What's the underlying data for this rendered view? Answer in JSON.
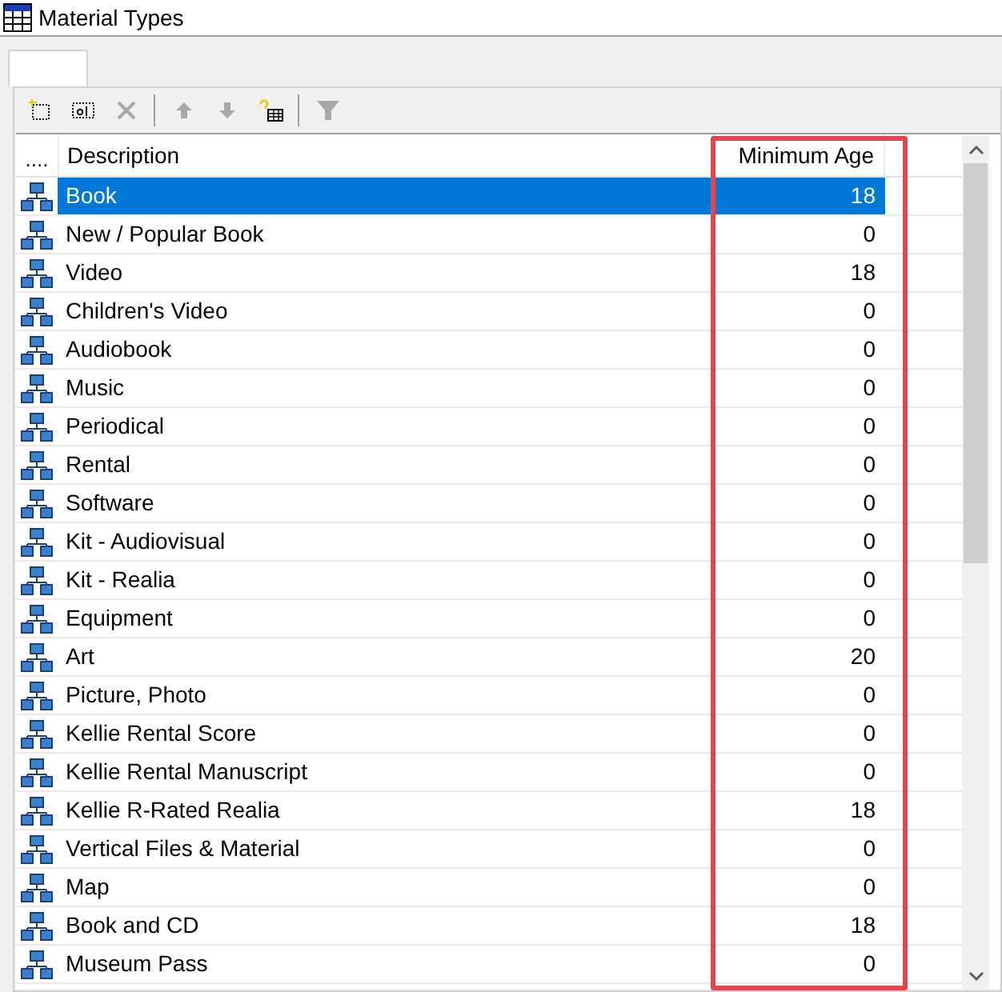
{
  "window": {
    "title": "Material Types"
  },
  "table": {
    "columns": [
      "....",
      "Description",
      "Minimum Age"
    ],
    "rows": [
      {
        "description": "Book",
        "minimum_age": "18",
        "selected": true
      },
      {
        "description": "New / Popular Book",
        "minimum_age": "0",
        "selected": false
      },
      {
        "description": "Video",
        "minimum_age": "18",
        "selected": false
      },
      {
        "description": "Children's Video",
        "minimum_age": "0",
        "selected": false
      },
      {
        "description": "Audiobook",
        "minimum_age": "0",
        "selected": false
      },
      {
        "description": "Music",
        "minimum_age": "0",
        "selected": false
      },
      {
        "description": "Periodical",
        "minimum_age": "0",
        "selected": false
      },
      {
        "description": "Rental",
        "minimum_age": "0",
        "selected": false
      },
      {
        "description": "Software",
        "minimum_age": "0",
        "selected": false
      },
      {
        "description": "Kit - Audiovisual",
        "minimum_age": "0",
        "selected": false
      },
      {
        "description": "Kit - Realia",
        "minimum_age": "0",
        "selected": false
      },
      {
        "description": "Equipment",
        "minimum_age": "0",
        "selected": false
      },
      {
        "description": "Art",
        "minimum_age": "20",
        "selected": false
      },
      {
        "description": "Picture, Photo",
        "minimum_age": "0",
        "selected": false
      },
      {
        "description": "Kellie Rental Score",
        "minimum_age": "0",
        "selected": false
      },
      {
        "description": "Kellie Rental Manuscript",
        "minimum_age": "0",
        "selected": false
      },
      {
        "description": "Kellie R-Rated Realia",
        "minimum_age": "18",
        "selected": false
      },
      {
        "description": "Vertical Files & Material",
        "minimum_age": "0",
        "selected": false
      },
      {
        "description": "Map",
        "minimum_age": "0",
        "selected": false
      },
      {
        "description": "Book and CD",
        "minimum_age": "18",
        "selected": false
      },
      {
        "description": "Museum Pass",
        "minimum_age": "0",
        "selected": false
      }
    ]
  }
}
